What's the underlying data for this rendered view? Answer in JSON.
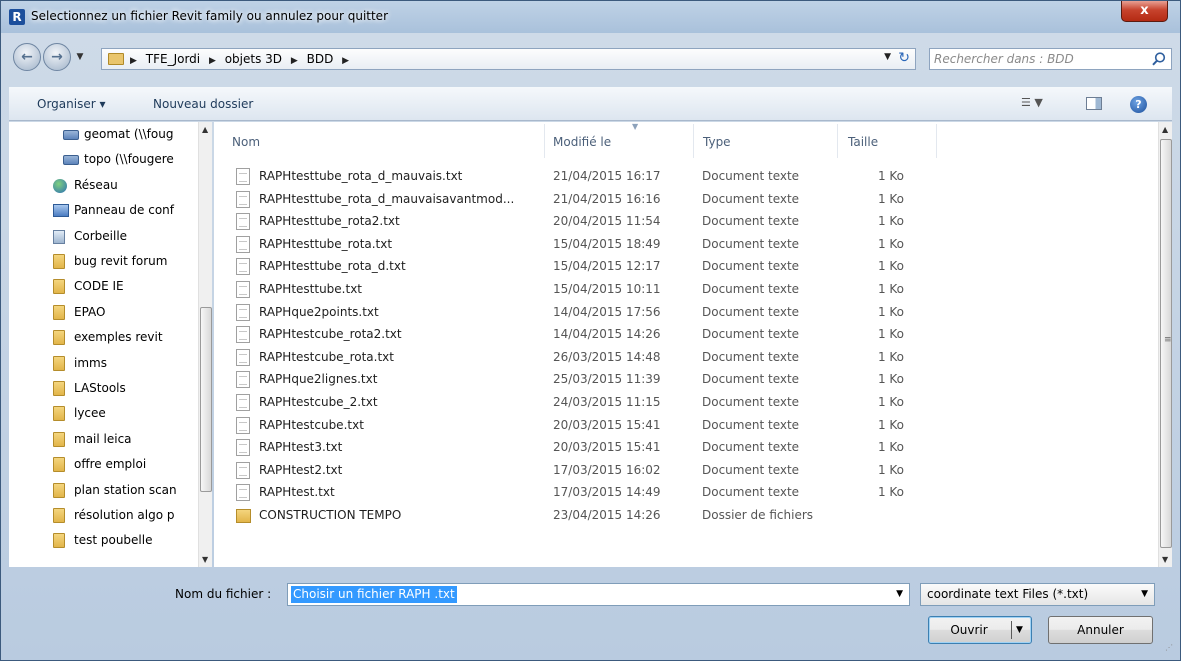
{
  "window": {
    "title": "Selectionnez un fichier Revit family ou annulez pour quitter",
    "close_label": "x"
  },
  "address": {
    "crumbs": [
      "TFE_Jordi",
      "objets 3D",
      "BDD"
    ],
    "search_placeholder": "Rechercher dans : BDD"
  },
  "toolbar": {
    "organise_label": "Organiser ▾",
    "new_folder_label": "Nouveau dossier"
  },
  "nav": {
    "items": [
      {
        "label": "geomat (\\\\foug",
        "icon": "network-drive-icon"
      },
      {
        "label": "topo (\\\\fougere",
        "icon": "network-drive-icon"
      },
      {
        "label": "Réseau",
        "icon": "network-icon"
      },
      {
        "label": "Panneau de conf",
        "icon": "control-panel-icon"
      },
      {
        "label": "Corbeille",
        "icon": "recycle-bin-icon"
      },
      {
        "label": "bug revit forum",
        "icon": "folder-icon"
      },
      {
        "label": "CODE IE",
        "icon": "folder-icon"
      },
      {
        "label": "EPAO",
        "icon": "folder-icon"
      },
      {
        "label": "exemples revit",
        "icon": "folder-icon"
      },
      {
        "label": "imms",
        "icon": "folder-icon"
      },
      {
        "label": "LAStools",
        "icon": "folder-icon"
      },
      {
        "label": "lycee",
        "icon": "folder-icon"
      },
      {
        "label": "mail leica",
        "icon": "folder-icon"
      },
      {
        "label": "offre emploi",
        "icon": "folder-icon"
      },
      {
        "label": "plan station scan",
        "icon": "folder-icon"
      },
      {
        "label": "résolution algo p",
        "icon": "folder-icon"
      },
      {
        "label": "test poubelle",
        "icon": "folder-icon"
      }
    ]
  },
  "files": {
    "columns": {
      "name": "Nom",
      "modified": "Modifié le",
      "type": "Type",
      "size": "Taille"
    },
    "rows": [
      {
        "name": "RAPHtesttube_rota_d_mauvais.txt",
        "date": "21/04/2015 16:17",
        "type": "Document texte",
        "size": "1 Ko"
      },
      {
        "name": "RAPHtesttube_rota_d_mauvaisavantmod...",
        "date": "21/04/2015 16:16",
        "type": "Document texte",
        "size": "1 Ko"
      },
      {
        "name": "RAPHtesttube_rota2.txt",
        "date": "20/04/2015 11:54",
        "type": "Document texte",
        "size": "1 Ko"
      },
      {
        "name": "RAPHtesttube_rota.txt",
        "date": "15/04/2015 18:49",
        "type": "Document texte",
        "size": "1 Ko"
      },
      {
        "name": "RAPHtesttube_rota_d.txt",
        "date": "15/04/2015 12:17",
        "type": "Document texte",
        "size": "1 Ko"
      },
      {
        "name": "RAPHtesttube.txt",
        "date": "15/04/2015 10:11",
        "type": "Document texte",
        "size": "1 Ko"
      },
      {
        "name": "RAPHque2points.txt",
        "date": "14/04/2015 17:56",
        "type": "Document texte",
        "size": "1 Ko"
      },
      {
        "name": "RAPHtestcube_rota2.txt",
        "date": "14/04/2015 14:26",
        "type": "Document texte",
        "size": "1 Ko"
      },
      {
        "name": "RAPHtestcube_rota.txt",
        "date": "26/03/2015 14:48",
        "type": "Document texte",
        "size": "1 Ko"
      },
      {
        "name": "RAPHque2lignes.txt",
        "date": "25/03/2015 11:39",
        "type": "Document texte",
        "size": "1 Ko"
      },
      {
        "name": "RAPHtestcube_2.txt",
        "date": "24/03/2015 11:15",
        "type": "Document texte",
        "size": "1 Ko"
      },
      {
        "name": "RAPHtestcube.txt",
        "date": "20/03/2015 15:41",
        "type": "Document texte",
        "size": "1 Ko"
      },
      {
        "name": "RAPHtest3.txt",
        "date": "20/03/2015 15:41",
        "type": "Document texte",
        "size": "1 Ko"
      },
      {
        "name": "RAPHtest2.txt",
        "date": "17/03/2015 16:02",
        "type": "Document texte",
        "size": "1 Ko"
      },
      {
        "name": "RAPHtest.txt",
        "date": "17/03/2015 14:49",
        "type": "Document texte",
        "size": "1 Ko"
      },
      {
        "name": "CONSTRUCTION TEMPO",
        "date": "23/04/2015 14:26",
        "type": "Dossier de fichiers",
        "size": "",
        "folder": true
      }
    ]
  },
  "bottom": {
    "filename_label": "Nom du fichier :",
    "filename_value": "Choisir un fichier RAPH .txt",
    "filter_value": "coordinate text Files (*.txt)",
    "open_label": "Ouvrir",
    "cancel_label": "Annuler"
  },
  "colors": {
    "selection": "#3399ff",
    "accent": "#1c4f9c"
  }
}
